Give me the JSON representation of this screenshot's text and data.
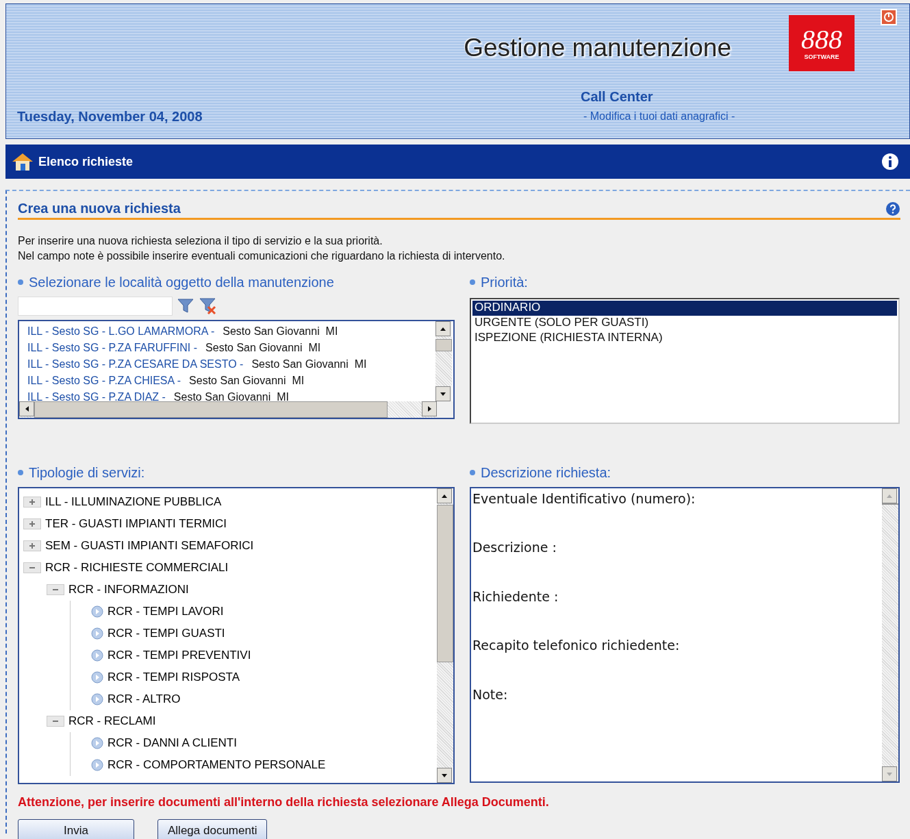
{
  "header": {
    "title": "Gestione manutenzione",
    "date": "Tuesday, November 04, 2008",
    "logo": {
      "mark": "888",
      "caption": "SOFTWARE"
    },
    "role": "Call Center",
    "profile_link": "- Modifica i tuoi dati anagrafici -"
  },
  "navbar": {
    "title": "Elenco richieste"
  },
  "section": {
    "title": "Crea una nuova richiesta",
    "intro": [
      "Per inserire una nuova richiesta seleziona il tipo di servizio e la sua priorità.",
      "Nel campo note è possibile inserire eventuali comunicazioni che riguardano la richiesta di intervento."
    ]
  },
  "locations": {
    "label": "Selezionare le località oggetto della manutenzione",
    "items": [
      {
        "code": "ILL - Sesto SG - L.GO LAMARMORA -",
        "city": "Sesto San Giovanni  MI"
      },
      {
        "code": "ILL - Sesto SG - P.ZA FARUFFINI -",
        "city": "Sesto San Giovanni  MI"
      },
      {
        "code": "ILL - Sesto SG - P.ZA CESARE DA SESTO -",
        "city": "Sesto San Giovanni  MI"
      },
      {
        "code": "ILL - Sesto SG - P.ZA CHIESA -",
        "city": "Sesto San Giovanni  MI"
      },
      {
        "code": "ILL - Sesto SG - P.ZA DIAZ -",
        "city": "Sesto San Giovanni  MI"
      }
    ]
  },
  "priority": {
    "label": "Priorità:",
    "options": [
      {
        "label": "ORDINARIO",
        "selected": true
      },
      {
        "label": "URGENTE (SOLO PER GUASTI)",
        "selected": false
      },
      {
        "label": "ISPEZIONE (RICHIESTA INTERNA)",
        "selected": false
      }
    ]
  },
  "services": {
    "label": "Tipologie di servizi:",
    "tree": [
      {
        "kind": "group",
        "label": "ILL - ILLUMINAZIONE PUBBLICA",
        "expanded": false
      },
      {
        "kind": "group",
        "label": "TER - GUASTI IMPIANTI TERMICI",
        "expanded": false
      },
      {
        "kind": "group",
        "label": "SEM - GUASTI IMPIANTI SEMAFORICI",
        "expanded": false
      },
      {
        "kind": "group",
        "label": "RCR - RICHIESTE COMMERCIALI",
        "expanded": true,
        "children": [
          {
            "kind": "group",
            "label": "RCR - INFORMAZIONI",
            "expanded": true,
            "children": [
              {
                "kind": "leaf",
                "label": "RCR - TEMPI LAVORI"
              },
              {
                "kind": "leaf",
                "label": "RCR - TEMPI GUASTI"
              },
              {
                "kind": "leaf",
                "label": "RCR - TEMPI PREVENTIVI"
              },
              {
                "kind": "leaf",
                "label": "RCR - TEMPI RISPOSTA"
              },
              {
                "kind": "leaf",
                "label": "RCR - ALTRO"
              }
            ]
          },
          {
            "kind": "group",
            "label": "RCR - RECLAMI",
            "expanded": true,
            "children": [
              {
                "kind": "leaf",
                "label": "RCR - DANNI A CLIENTI"
              },
              {
                "kind": "leaf",
                "label": "RCR - COMPORTAMENTO PERSONALE"
              }
            ]
          }
        ]
      }
    ]
  },
  "description": {
    "label": "Descrizione richiesta:",
    "value": "Eventuale Identificativo (numero):\n\n\nDescrizione :\n\n\nRichiedente :\n\n\nRecapito telefonico richiedente:\n\n\nNote:"
  },
  "warning": "Attenzione, per inserire documenti all'interno della richiesta selezionare Allega Documenti.",
  "buttons": [
    "Invia",
    "Allega documenti"
  ]
}
